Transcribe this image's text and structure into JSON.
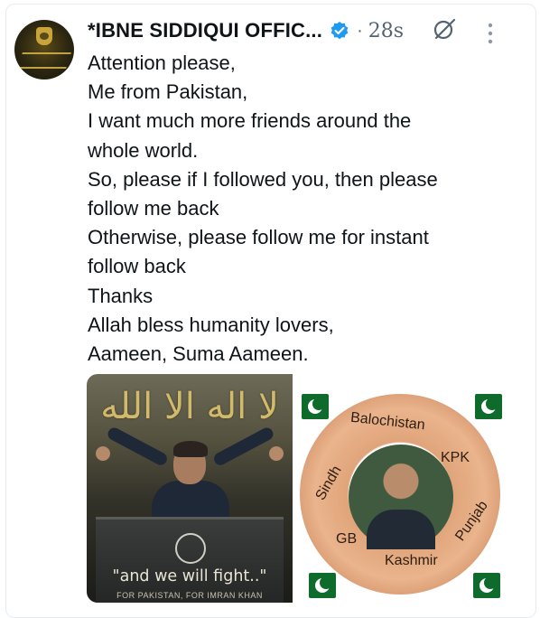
{
  "post": {
    "author_name": "*IBNE SIDDIQUI OFFIC...",
    "separator": "·",
    "time": "28s",
    "text_lines": [
      "Attention please,",
      "Me from Pakistan,",
      "I want much more friends around the",
      "whole world.",
      "So, please if I followed you, then please",
      "follow me back",
      "Otherwise, please follow me for instant",
      "follow back",
      "Thanks",
      "Allah bless humanity lovers,",
      "Aameen, Suma Aameen."
    ]
  },
  "icons": {
    "verified": "verified-badge-icon",
    "grok": "grok-icon",
    "more": "more-options-icon"
  },
  "media": {
    "left_image": {
      "caption": "\"and we will fight..\"",
      "subcaption": "FOR PAKISTAN, FOR IMRAN KHAN"
    },
    "right_image": {
      "regions": [
        "Balochistan",
        "KPK",
        "Sindh",
        "Punjab",
        "GB",
        "Kashmir"
      ]
    }
  },
  "colors": {
    "text": "#0f1419",
    "muted": "#536471",
    "verified": "#1d9bf0",
    "border": "#e6ecf0",
    "flag_green": "#0f6b2c"
  }
}
